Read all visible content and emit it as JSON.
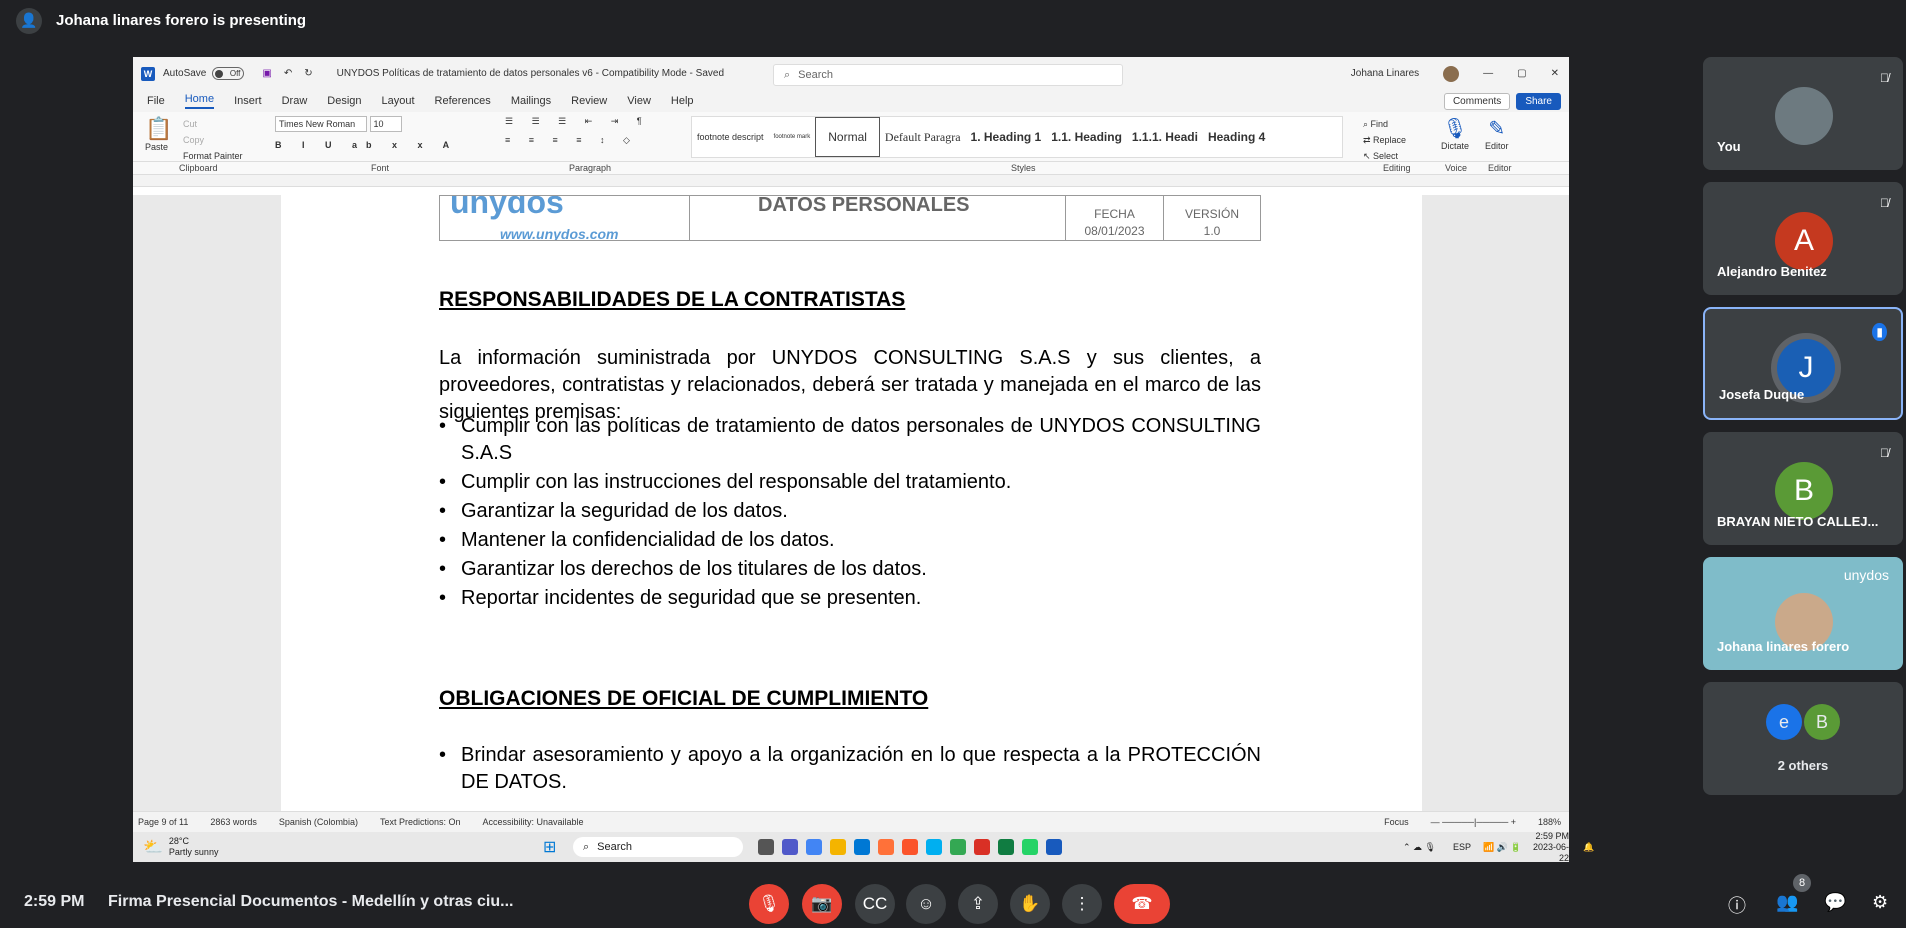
{
  "presenter_banner": "Johana linares forero is presenting",
  "word": {
    "autosave_label": "AutoSave",
    "autosave_state": "Off",
    "doc_title": "UNYDOS Políticas de tratamiento de datos personales v6 - Compatibility Mode - Saved",
    "search_placeholder": "Search",
    "user": "Johana Linares",
    "menu": [
      "File",
      "Home",
      "Insert",
      "Draw",
      "Design",
      "Layout",
      "References",
      "Mailings",
      "Review",
      "View",
      "Help"
    ],
    "comments": "Comments",
    "share": "Share",
    "ribbon": {
      "paste": "Paste",
      "cut": "Cut",
      "copy": "Copy",
      "format_painter": "Format Painter",
      "font_name": "Times New Roman",
      "font_size": "10",
      "styles": [
        "footnote descript",
        "footnote mark",
        "Normal",
        "Default Paragra",
        "1. Heading 1",
        "1.1. Heading",
        "1.1.1. Headi",
        "Heading 4"
      ],
      "find": "Find",
      "replace": "Replace",
      "select": "Select",
      "dictate": "Dictate",
      "editor": "Editor",
      "groups": [
        "Clipboard",
        "Font",
        "Paragraph",
        "Styles",
        "Editing",
        "Voice",
        "Editor"
      ]
    },
    "header": {
      "logo": "unydos",
      "url": "www.unydos.com",
      "title": "DATOS PERSONALES",
      "fecha_label": "FECHA",
      "fecha": "08/01/2023",
      "version_label": "VERSIÓN",
      "version": "1.0"
    },
    "heading1": "RESPONSABILIDADES DE LA CONTRATISTAS",
    "para1": "La información suministrada por UNYDOS CONSULTING S.A.S y sus clientes, a proveedores, contratistas y relacionados, deberá ser tratada y manejada en el marco de las siguientes premisas:",
    "bullets1": [
      "Cumplir con las políticas de tratamiento de datos personales de UNYDOS CONSULTING S.A.S",
      "Cumplir con las instrucciones del responsable del tratamiento.",
      "Garantizar la seguridad de los datos.",
      "Mantener la confidencialidad de los datos.",
      "Garantizar los derechos de los titulares de los datos.",
      "Reportar incidentes de seguridad que se presenten."
    ],
    "heading2": "OBLIGACIONES DE OFICIAL DE CUMPLIMIENTO",
    "bullets2": [
      "Brindar asesoramiento y apoyo a la organización en lo que respecta a la PROTECCIÓN DE DATOS."
    ],
    "status": {
      "page": "Page 9 of 11",
      "words": "2863 words",
      "language": "Spanish (Colombia)",
      "predictions": "Text Predictions: On",
      "accessibility": "Accessibility: Unavailable",
      "focus": "Focus",
      "zoom": "188%"
    }
  },
  "taskbar": {
    "weather_temp": "28°C",
    "weather_desc": "Partly sunny",
    "search": "Search",
    "lang": "ESP",
    "time": "2:59 PM",
    "date": "2023-06-22"
  },
  "participants": [
    {
      "name": "You",
      "initial": "",
      "color": "#6d7a80"
    },
    {
      "name": "Alejandro Benitez",
      "initial": "A",
      "color": "#c5391f"
    },
    {
      "name": "Josefa Duque",
      "initial": "J",
      "color": "#1a5fb4"
    },
    {
      "name": "BRAYAN NIETO CALLEJ...",
      "initial": "B",
      "color": "#5a9a36"
    },
    {
      "name": "Johana linares forero",
      "initial": "",
      "color": "#6fb0c0"
    },
    {
      "name": "2 others",
      "initial": "",
      "color": "#3c4043"
    }
  ],
  "tile_logo": "unydos",
  "others_initials": [
    "e",
    "B"
  ],
  "meeting": {
    "time": "2:59 PM",
    "title": "Firma Presencial Documentos - Medellín y otras ciu...",
    "people_count": "8"
  }
}
